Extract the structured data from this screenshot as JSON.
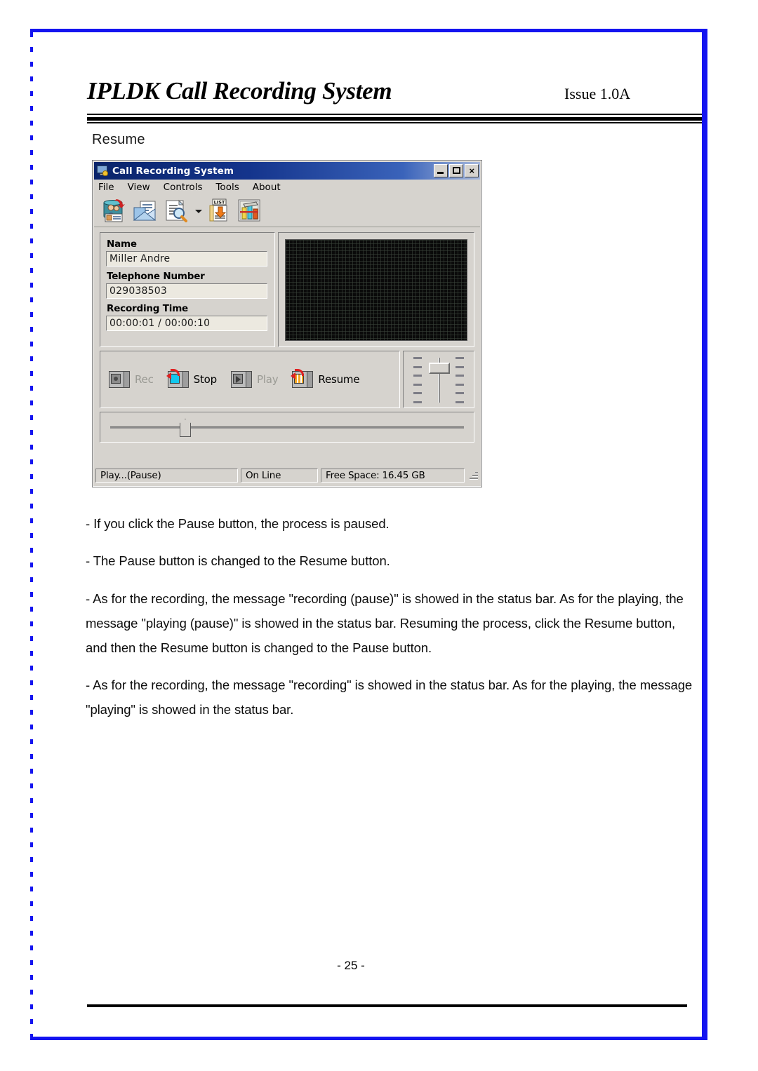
{
  "document": {
    "header": {
      "title": "IPLDK Call Recording System",
      "issue": "Issue 1.0A"
    },
    "section_label": "Resume",
    "page_number": "- 25 -",
    "border_color": "#1414f0"
  },
  "app": {
    "titlebar": {
      "title": "Call Recording System",
      "icon": "monitor-bell-icon",
      "minimize_label": "_",
      "maximize_label": "",
      "close_label": "×",
      "gradient_start": "#0a246a",
      "gradient_end": "#a6b8dc"
    },
    "menubar": {
      "items": [
        {
          "label": "File"
        },
        {
          "label": "View"
        },
        {
          "label": "Controls"
        },
        {
          "label": "Tools"
        },
        {
          "label": "About"
        }
      ]
    },
    "toolbar": {
      "buttons": [
        {
          "icon": "phonebook-contacts-icon",
          "tooltip": "Phone Book"
        },
        {
          "icon": "mail-envelope-icon",
          "tooltip": "Message"
        },
        {
          "icon": "document-search-icon",
          "tooltip": "Search"
        },
        {
          "icon": "chevron-down-icon",
          "tooltip": "More"
        },
        {
          "icon": "list-download-icon",
          "tooltip": "List"
        },
        {
          "icon": "settings-tools-icon",
          "tooltip": "Setup"
        }
      ]
    },
    "fields": {
      "name_label": "Name",
      "name_value": "Miller Andre",
      "phone_label": "Telephone Number",
      "phone_value": "029038503",
      "time_label": "Recording Time",
      "time_value": "00:00:01 / 00:00:10"
    },
    "display": {
      "type": "led-matrix",
      "background": "#0a0a0a"
    },
    "transport": [
      {
        "label": "Rec",
        "icon": "record-icon",
        "enabled": false
      },
      {
        "label": "Stop",
        "icon": "stop-icon",
        "enabled": true
      },
      {
        "label": "Play",
        "icon": "play-icon",
        "enabled": false
      },
      {
        "label": "Resume",
        "icon": "resume-icon",
        "enabled": true
      }
    ],
    "volume": {
      "name": "volume-slider",
      "orientation": "vertical",
      "position_percent": 88,
      "tick_count": 6
    },
    "seek": {
      "name": "seek-slider",
      "orientation": "horizontal",
      "position_percent": 21
    },
    "statusbar": {
      "panel1": "Play...(Pause)",
      "panel2": "On Line",
      "panel3": "Free Space: 16.45 GB"
    }
  },
  "body": {
    "paragraphs": [
      "- If you click the Pause button, the process is paused.",
      "- The Pause button is changed to the Resume button.",
      "- As for the recording, the message \"recording (pause)\" is showed in the status bar. As for the playing, the message \"playing (pause)\" is showed in the status bar. Resuming the process, click the Resume button, and then the Resume button is changed to the Pause button.",
      "- As for the recording, the message \"recording\" is showed in the status bar. As for the playing, the message \"playing\" is showed in the status bar."
    ]
  }
}
